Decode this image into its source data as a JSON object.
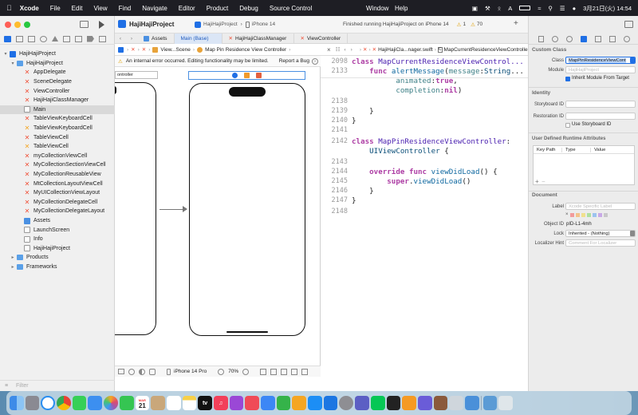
{
  "menubar": {
    "app_name": "Xcode",
    "items": [
      "File",
      "Edit",
      "View",
      "Find",
      "Navigate",
      "Editor",
      "Product",
      "Debug",
      "Source Control"
    ],
    "window": "Window",
    "help": "Help",
    "datetime": "3月21日(火) 14:54"
  },
  "toolbar": {
    "project": "HajiHajiProject",
    "scheme": "HajiHajiProject",
    "device": "iPhone 14",
    "status": "Finished running HajiHajiProject on iPhone 14",
    "warnings": "1",
    "issues": "70"
  },
  "navigator": {
    "project_root": "HajiHajiProject",
    "group": "HajiHajiProject",
    "files": [
      {
        "name": "AppDelegate",
        "kind": "swift"
      },
      {
        "name": "SceneDelegate",
        "kind": "swift"
      },
      {
        "name": "ViewController",
        "kind": "swift"
      },
      {
        "name": "HajiHajiClassManager",
        "kind": "swift"
      },
      {
        "name": "Main",
        "kind": "storyboard"
      },
      {
        "name": "TableViewKeyboardCell",
        "kind": "swift"
      },
      {
        "name": "TableViewKeyboardCell",
        "kind": "xib"
      },
      {
        "name": "TableViewCell",
        "kind": "swift"
      },
      {
        "name": "TableViewCell",
        "kind": "xib"
      },
      {
        "name": "myCollectionViewCell",
        "kind": "swift"
      },
      {
        "name": "MyCollectionSectionViewCell",
        "kind": "swift"
      },
      {
        "name": "MyCollectionReusableView",
        "kind": "swift"
      },
      {
        "name": "MtCollectionLayoutViewCell",
        "kind": "swift"
      },
      {
        "name": "MyUICollectionViewLayout",
        "kind": "swift"
      },
      {
        "name": "MyCollectionDelegateCell",
        "kind": "swift"
      },
      {
        "name": "MyCollectionDelegateLayout",
        "kind": "swift"
      },
      {
        "name": "Assets",
        "kind": "assets"
      },
      {
        "name": "LaunchScreen",
        "kind": "storyboard"
      },
      {
        "name": "Info",
        "kind": "plist"
      },
      {
        "name": "HajiHajiProject",
        "kind": "file"
      }
    ],
    "groups_closed": [
      "Products",
      "Frameworks"
    ],
    "filter_placeholder": "Filter"
  },
  "tabs": [
    {
      "label": "Assets",
      "active": false
    },
    {
      "label": "Main (Base)",
      "active": true
    },
    {
      "label": "HajiHajiClassManager",
      "active": false
    },
    {
      "label": "ViewController",
      "active": false
    }
  ],
  "storyboard": {
    "jumpbar": [
      "View...Scene",
      "Map Pin Residence View Controller"
    ],
    "warning": "An internal error occurred. Editing functionality may be limited.",
    "report_bug": "Report a Bug",
    "left_scene_title": "ontroller",
    "device": "iPhone 14 Pro",
    "zoom": "70%"
  },
  "code_editor": {
    "jumpbar": [
      "HajiHajiCla...nager.swift",
      "MapCurrentResidenceViewController"
    ],
    "lines": [
      {
        "n": "2098",
        "code": "class MapCurrentResidenceViewControl..."
      },
      {
        "n": "2133",
        "code": "    func alertMessage(message:String..."
      },
      {
        "n": "",
        "code": "          animated:true,"
      },
      {
        "n": "",
        "code": "          completion:nil)"
      },
      {
        "n": "2138",
        "code": ""
      },
      {
        "n": "2139",
        "code": "    }"
      },
      {
        "n": "2140",
        "code": "}"
      },
      {
        "n": "2141",
        "code": ""
      },
      {
        "n": "2142",
        "code": "class MapPinResidenceViewController:"
      },
      {
        "n": "",
        "code": "    UIViewController {"
      },
      {
        "n": "2143",
        "code": ""
      },
      {
        "n": "2144",
        "code": "    override func viewDidLoad() {"
      },
      {
        "n": "2145",
        "code": "        super.viewDidLoad()"
      },
      {
        "n": "2146",
        "code": "    }"
      },
      {
        "n": "2147",
        "code": "}"
      },
      {
        "n": "2148",
        "code": ""
      }
    ]
  },
  "inspector": {
    "custom_class_header": "Custom Class",
    "class_label": "Class",
    "class_value": "MapPinResidenceViewCont",
    "module_label": "Module",
    "module_placeholder": "HajiHajiProject",
    "inherit_label": "Inherit Module From Target",
    "identity_header": "Identity",
    "storyboard_id_label": "Storyboard ID",
    "restoration_id_label": "Restoration ID",
    "use_storyboard_label": "Use Storyboard ID",
    "udra_header": "User Defined Runtime Attributes",
    "udra_cols": [
      "Key Path",
      "Type",
      "Value"
    ],
    "document_header": "Document",
    "doc_label": "Label",
    "doc_label_placeholder": "Xcode Specific Label",
    "object_id_label": "Object ID",
    "object_id_value": "pID-L1-4mh",
    "lock_label": "Lock",
    "lock_value": "Inherited - (Nothing)",
    "localizer_label": "Localizer Hint",
    "localizer_placeholder": "Comment For Localizer"
  },
  "dock": {
    "calendar_day": "21",
    "calendar_month": "MAR",
    "tv": "tv"
  },
  "colors": {
    "accent": "#1f6fe5",
    "swift": "#f05138",
    "keyword": "#ad3da4",
    "type": "#4b21b0"
  }
}
